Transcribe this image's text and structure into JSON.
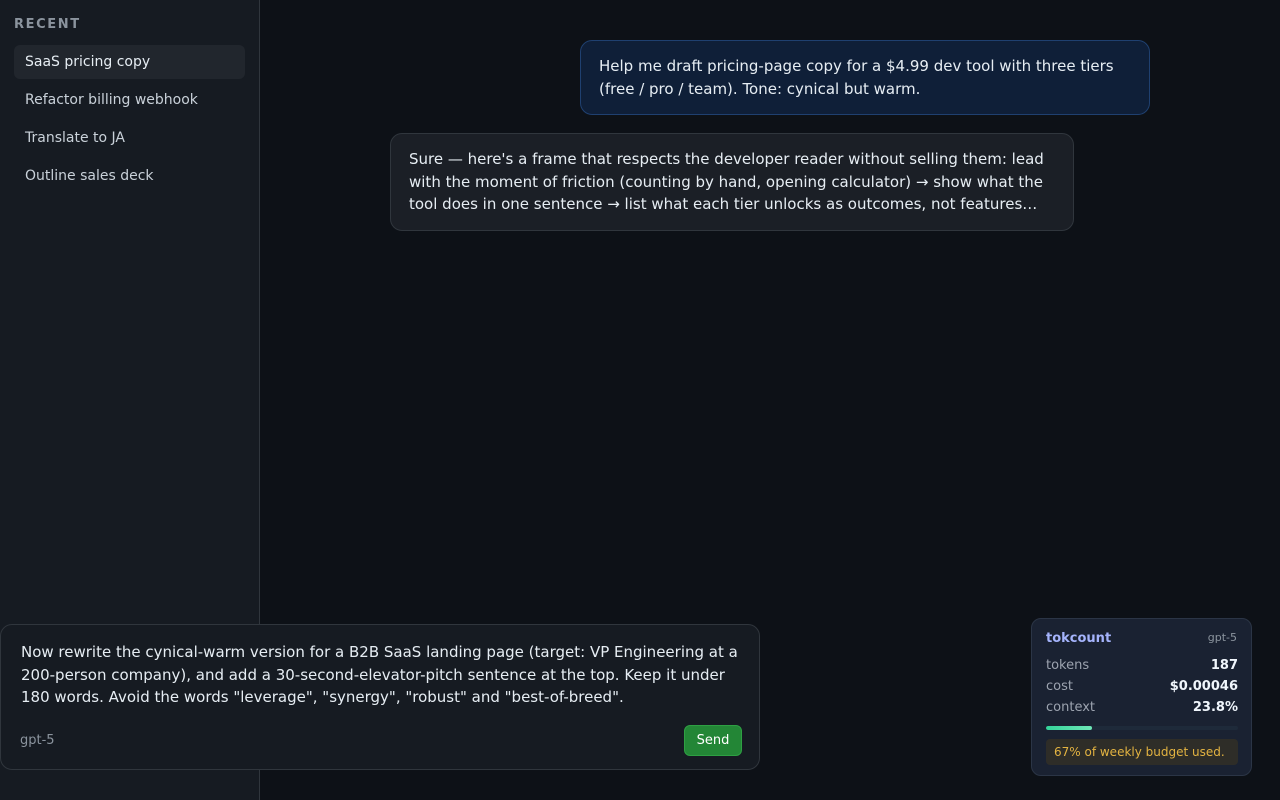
{
  "sidebar": {
    "heading": "RECENT",
    "items": [
      {
        "label": "SaaS pricing copy",
        "active": true
      },
      {
        "label": "Refactor billing webhook",
        "active": false
      },
      {
        "label": "Translate to JA",
        "active": false
      },
      {
        "label": "Outline sales deck",
        "active": false
      }
    ]
  },
  "chat": {
    "messages": [
      {
        "role": "user",
        "text": "Help me draft pricing-page copy for a $4.99 dev tool with three tiers (free / pro / team). Tone: cynical but warm."
      },
      {
        "role": "assistant",
        "text": "Sure — here's a frame that respects the developer reader without selling them: lead with the moment of friction (counting by hand, opening calculator) → show what the tool does in one sentence → list what each tier unlocks as outcomes, not features…"
      }
    ]
  },
  "composer": {
    "text": "Now rewrite the cynical-warm version for a B2B SaaS landing page (target: VP Engineering at a 200-person company), and add a 30-second-elevator-pitch sentence at the top. Keep it under 180 words. Avoid the words \"leverage\", \"synergy\", \"robust\" and \"best-of-breed\".",
    "model": "gpt-5",
    "send_label": "Send"
  },
  "tokcount": {
    "title": "tokcount",
    "model": "gpt-5",
    "rows": [
      {
        "label": "tokens",
        "value": "187"
      },
      {
        "label": "cost",
        "value": "$0.00046"
      },
      {
        "label": "context",
        "value": "23.8%"
      }
    ],
    "context_fraction": 0.238,
    "alert": "67% of weekly budget used."
  },
  "colors": {
    "accent": "#a5b4fc",
    "send": "#238636",
    "progress": "#34d399",
    "warning": "#e3b341"
  }
}
